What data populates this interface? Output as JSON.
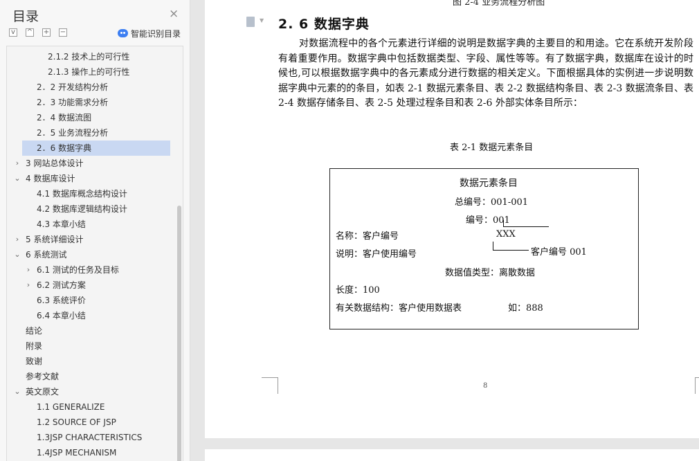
{
  "sidebar": {
    "title": "目录",
    "smart_label": "智能识别目录",
    "toolbar": {
      "collapse": "v",
      "up": "^",
      "add": "+",
      "remove": "−"
    },
    "items": [
      {
        "label": "2.1.2 技术上的可行性",
        "level": 3,
        "caret": ""
      },
      {
        "label": "2.1.3 操作上的可行性",
        "level": 3,
        "caret": ""
      },
      {
        "label": "2．2 开发结构分析",
        "level": 2,
        "caret": ""
      },
      {
        "label": "2．3 功能需求分析",
        "level": 2,
        "caret": ""
      },
      {
        "label": "2．4  数据流图",
        "level": 2,
        "caret": ""
      },
      {
        "label": "2．5  业务流程分析",
        "level": 2,
        "caret": ""
      },
      {
        "label": "2．6  数据字典",
        "level": 2,
        "caret": "",
        "active": true
      },
      {
        "label": "3    网站总体设计",
        "level": 1,
        "caret": "›"
      },
      {
        "label": "4    数据库设计",
        "level": 1,
        "caret": "⌄"
      },
      {
        "label": "4.1 数据库概念结构设计",
        "level": 2,
        "caret": ""
      },
      {
        "label": "4.2 数据库逻辑结构设计",
        "level": 2,
        "caret": ""
      },
      {
        "label": "4.3 本章小结",
        "level": 2,
        "caret": ""
      },
      {
        "label": "5    系统详细设计",
        "level": 1,
        "caret": "›"
      },
      {
        "label": "6    系统测试",
        "level": 1,
        "caret": "⌄"
      },
      {
        "label": "6.1  测试的任务及目标",
        "level": 2,
        "caret": "›"
      },
      {
        "label": "6.2  测试方案",
        "level": 2,
        "caret": "›"
      },
      {
        "label": "6.3 系统评价",
        "level": 2,
        "caret": ""
      },
      {
        "label": "6.4 本章小结",
        "level": 2,
        "caret": ""
      },
      {
        "label": "结论",
        "level": 1,
        "caret": ""
      },
      {
        "label": "附录",
        "level": 1,
        "caret": ""
      },
      {
        "label": "致谢",
        "level": 1,
        "caret": ""
      },
      {
        "label": "参考文献",
        "level": 1,
        "caret": ""
      },
      {
        "label": "英文原文",
        "level": 1,
        "caret": "⌄"
      },
      {
        "label": "1.1 GENERALIZE",
        "level": 2,
        "caret": ""
      },
      {
        "label": "1.2 SOURCE OF JSP",
        "level": 2,
        "caret": ""
      },
      {
        "label": "1.3JSP CHARACTERISTICS",
        "level": 2,
        "caret": ""
      },
      {
        "label": "1.4JSP MECHANISM",
        "level": 2,
        "caret": ""
      }
    ]
  },
  "document": {
    "top_caption": "图 2-4  业务流程分析图",
    "heading": "2. 6  数据字典",
    "paragraph": "对数据流程中的各个元素进行详细的说明是数据字典的主要目的和用途。它在系统开发阶段有着重要作用。数据字典中包括数据类型、字段、属性等等。有了数据字典，数据库在设计的时候也,可以根据数据字典中的各元素成分进行数据的相关定义。下面根据具体的实例进一步说明数据字典中元素的的条目，如表 2-1 数据元素条目、表 2-2 数据结构条目、表 2-3 数据流条目、表 2-4  数据存储条目、表 2-5  处理过程条目和表 2-6  外部实体条目所示：",
    "table_caption": "表 2-1  数据元素条目",
    "page_number": "8",
    "entry": {
      "title": "数据元素条目",
      "total_no": "总编号：001-001",
      "no": "编号：001",
      "name": "名称：客户编号",
      "xxx": "XXX",
      "desc": "说明：客户使用编号",
      "annot": "客户编号  001",
      "value_type": "数据值类型：离散数据",
      "length": "长度：100",
      "related": "有关数据结构：客户使用数据表",
      "example": "如：888"
    }
  }
}
